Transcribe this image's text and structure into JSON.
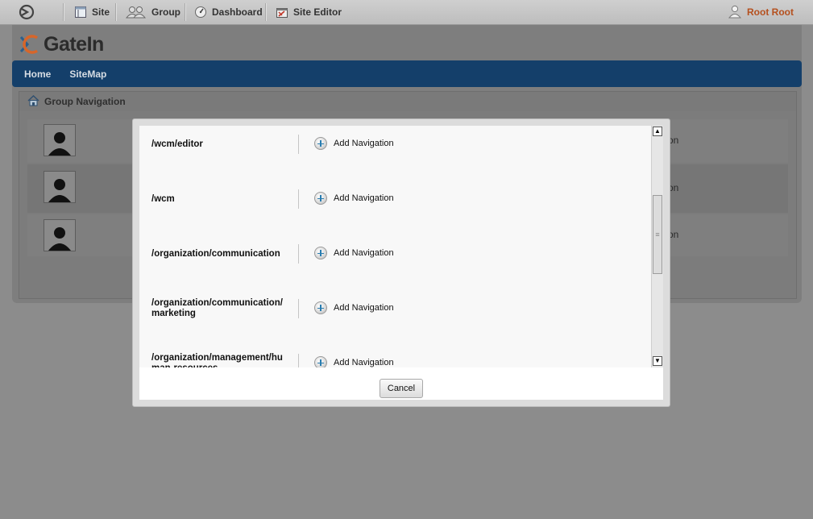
{
  "toolbar": {
    "items": [
      {
        "label": "Site",
        "icon": "site-icon"
      },
      {
        "label": "Group",
        "icon": "group-icon"
      },
      {
        "label": "Dashboard",
        "icon": "dashboard-icon"
      },
      {
        "label": "Site Editor",
        "icon": "site-editor-icon"
      }
    ],
    "user": "Root Root"
  },
  "brand": {
    "name": "GateIn"
  },
  "nav": {
    "items": [
      "Home",
      "SiteMap"
    ]
  },
  "portlet": {
    "title": "Group Navigation",
    "rows_partial_text": [
      "on",
      "on",
      "on"
    ]
  },
  "modal": {
    "rows": [
      {
        "group": "/wcm/editor",
        "action": "Add Navigation"
      },
      {
        "group": "/wcm",
        "action": "Add Navigation"
      },
      {
        "group": "/organization/communication",
        "action": "Add Navigation"
      },
      {
        "group": "/organization/communication/marketing",
        "action": "Add Navigation"
      },
      {
        "group": "/organization/management/human-resources",
        "action": "Add Navigation"
      }
    ],
    "cancel_label": "Cancel"
  },
  "colors": {
    "toolbar_bg": "#c6c6c6",
    "navbar_bg": "#143f6a",
    "user_text": "#b5501e",
    "overlay_bg": "#8c8c8c"
  }
}
